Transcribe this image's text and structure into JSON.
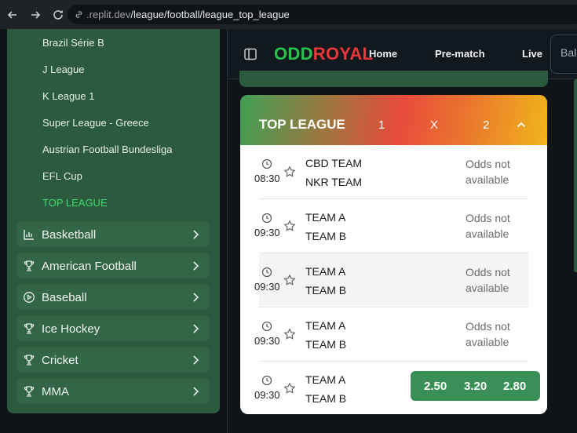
{
  "browser": {
    "url_host": ".replit.dev",
    "url_path": "/league/football/league_top_league"
  },
  "sidebar": {
    "sub_items": [
      {
        "label": "Brazil Série B",
        "active": false
      },
      {
        "label": "J League",
        "active": false
      },
      {
        "label": "K League 1",
        "active": false
      },
      {
        "label": "Super League - Greece",
        "active": false
      },
      {
        "label": "Austrian Football Bundesliga",
        "active": false
      },
      {
        "label": "EFL Cup",
        "active": false
      },
      {
        "label": "TOP LEAGUE",
        "active": true
      }
    ],
    "sports": [
      {
        "label": "Basketball",
        "icon": "bar-chart-icon"
      },
      {
        "label": "American Football",
        "icon": "trophy-icon"
      },
      {
        "label": "Baseball",
        "icon": "play-circle-icon"
      },
      {
        "label": "Ice Hockey",
        "icon": "trophy-icon"
      },
      {
        "label": "Cricket",
        "icon": "trophy-icon"
      },
      {
        "label": "MMA",
        "icon": "trophy-icon"
      }
    ]
  },
  "header": {
    "logo_part1": "ODD",
    "logo_part2": "ROYAL",
    "nav": [
      "Home",
      "Pre-match",
      "Live"
    ],
    "balance_partial": "Bal"
  },
  "league": {
    "title": "TOP LEAGUE",
    "col_1": "1",
    "col_x": "X",
    "col_2": "2",
    "matches": [
      {
        "time": "08:30",
        "home": "CBD TEAM",
        "away": "NKR TEAM",
        "odds_available": false,
        "odds_text_1": "Odds not",
        "odds_text_2": "available"
      },
      {
        "time": "09:30",
        "home": "TEAM A",
        "away": "TEAM B",
        "odds_available": false,
        "odds_text_1": "Odds not",
        "odds_text_2": "available"
      },
      {
        "time": "09:30",
        "home": "TEAM A",
        "away": "TEAM B",
        "odds_available": false,
        "odds_text_1": "Odds not",
        "odds_text_2": "available"
      },
      {
        "time": "09:30",
        "home": "TEAM A",
        "away": "TEAM B",
        "odds_available": false,
        "odds_text_1": "Odds not",
        "odds_text_2": "available"
      },
      {
        "time": "09:30",
        "home": "TEAM A",
        "away": "TEAM B",
        "odds_available": true,
        "odd_1": "2.50",
        "odd_x": "3.20",
        "odd_2": "2.80"
      }
    ]
  },
  "colors": {
    "sidebar_bg": "#2b5a3f",
    "sport_item_bg": "#326647",
    "active_link": "#3ddc6b",
    "logo_green": "#28c24f",
    "logo_red": "#e8363b",
    "odds_bg": "#3a8f57"
  }
}
